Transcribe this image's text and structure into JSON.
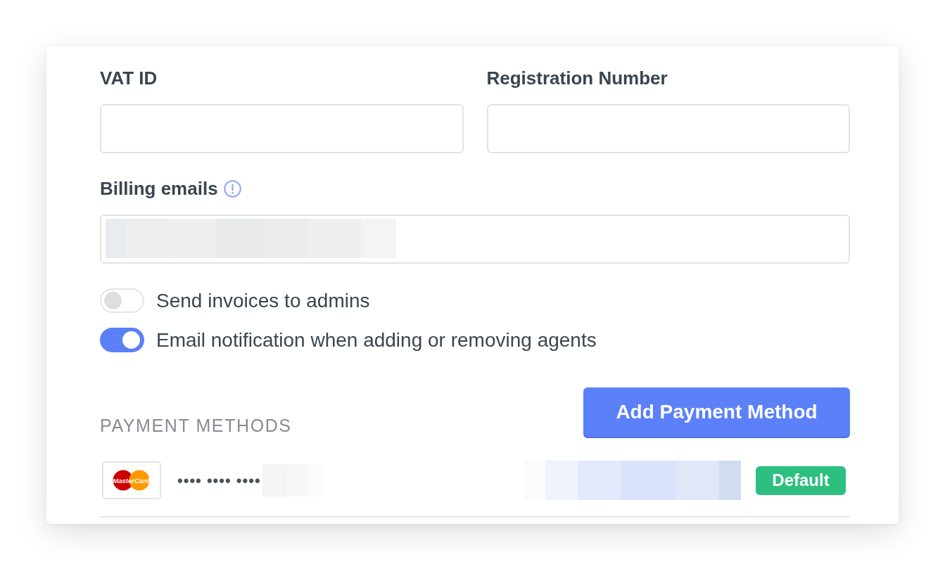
{
  "fields": [
    {
      "label": "VAT ID"
    },
    {
      "label": "Registration Number"
    }
  ],
  "billing_emails": {
    "label": "Billing emails"
  },
  "toggles": [
    {
      "label": "Send invoices to admins",
      "on": false
    },
    {
      "label": "Email notification when adding or removing agents",
      "on": true
    }
  ],
  "payment_methods": {
    "heading": "PAYMENT METHODS",
    "add_button": "Add Payment Method",
    "items": [
      {
        "brand": "MasterCard",
        "masked_number": "•••• •••• ••••",
        "badge": "Default"
      }
    ]
  }
}
